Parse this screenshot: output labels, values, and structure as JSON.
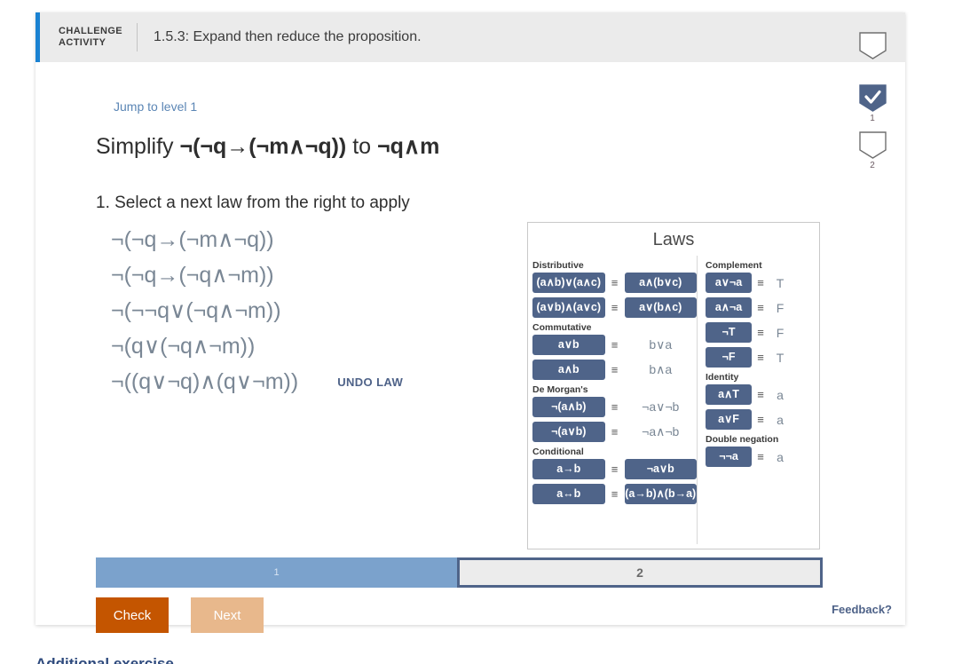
{
  "header": {
    "label_line1": "CHALLENGE",
    "label_line2": "ACTIVITY",
    "title": "1.5.3: Expand then reduce the proposition."
  },
  "rail": {
    "markers": [
      {
        "num": "1",
        "checked": true
      },
      {
        "num": "2",
        "checked": false
      }
    ]
  },
  "content": {
    "jump_link": "Jump to level 1",
    "simplify_prefix": "Simplify",
    "simplify_from": "¬(¬q→(¬m∧¬q))",
    "simplify_connector": "to",
    "simplify_to": "¬q∧m",
    "instruction": "1. Select a next law from the right to apply",
    "steps": [
      "¬(¬q→(¬m∧¬q))",
      "¬(¬q→(¬q∧¬m))",
      "¬(¬¬q∨(¬q∧¬m))",
      "¬(q∨(¬q∧¬m))",
      "¬((q∨¬q)∧(q∨¬m))"
    ],
    "undo_law": "UNDO LAW"
  },
  "laws": {
    "title": "Laws",
    "left_groups": [
      {
        "name": "Distributive",
        "rows": [
          {
            "lhs": "(a∧b)∨(a∧c)",
            "op": "≡",
            "rhs": "a∧(b∨c)",
            "rhs_button": true
          },
          {
            "lhs": "(a∨b)∧(a∨c)",
            "op": "≡",
            "rhs": "a∨(b∧c)",
            "rhs_button": true
          }
        ]
      },
      {
        "name": "Commutative",
        "rows": [
          {
            "lhs": "a∨b",
            "op": "≡",
            "rhs": "b∨a",
            "rhs_button": false
          },
          {
            "lhs": "a∧b",
            "op": "≡",
            "rhs": "b∧a",
            "rhs_button": false
          }
        ]
      },
      {
        "name": "De Morgan's",
        "rows": [
          {
            "lhs": "¬(a∧b)",
            "op": "≡",
            "rhs": "¬a∨¬b",
            "rhs_button": false
          },
          {
            "lhs": "¬(a∨b)",
            "op": "≡",
            "rhs": "¬a∧¬b",
            "rhs_button": false
          }
        ]
      },
      {
        "name": "Conditional",
        "rows": [
          {
            "lhs": "a→b",
            "op": "≡",
            "rhs": "¬a∨b",
            "rhs_button": true
          },
          {
            "lhs": "a↔b",
            "op": "≡",
            "rhs": "(a→b)∧(b→a)",
            "rhs_button": true
          }
        ]
      }
    ],
    "right_groups": [
      {
        "name": "Complement",
        "rows": [
          {
            "lhs": "a∨¬a",
            "op": "≡",
            "rhs": "T"
          },
          {
            "lhs": "a∧¬a",
            "op": "≡",
            "rhs": "F"
          },
          {
            "lhs": "¬T",
            "op": "≡",
            "rhs": "F"
          },
          {
            "lhs": "¬F",
            "op": "≡",
            "rhs": "T"
          }
        ]
      },
      {
        "name": "Identity",
        "rows": [
          {
            "lhs": "a∧T",
            "op": "≡",
            "rhs": "a"
          },
          {
            "lhs": "a∨F",
            "op": "≡",
            "rhs": "a"
          }
        ]
      },
      {
        "name": "Double negation",
        "rows": [
          {
            "lhs": "¬¬a",
            "op": "≡",
            "rhs": "a"
          }
        ]
      }
    ]
  },
  "progress": {
    "tabs": [
      {
        "label": "1",
        "state": "done"
      },
      {
        "label": "2",
        "state": "current"
      }
    ]
  },
  "actions": {
    "check": "Check",
    "next": "Next"
  },
  "feedback": "Feedback?",
  "cut_text": "Additional exercise",
  "colors": {
    "accent_blue": "#1a82d2",
    "law_button": "#4f6489",
    "check_orange": "#c45500",
    "next_orange": "#e8b88c",
    "tab_done": "#7ba2cc",
    "expr_gray": "#7a8795"
  }
}
